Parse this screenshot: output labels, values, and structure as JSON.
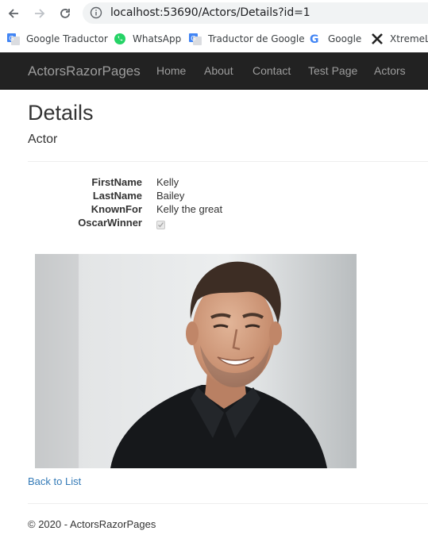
{
  "browser": {
    "url": "localhost:53690/Actors/Details?id=1",
    "bookmarks": [
      {
        "label": "Google Traductor",
        "icon": "google-translate-icon"
      },
      {
        "label": "WhatsApp",
        "icon": "whatsapp-icon"
      },
      {
        "label": "Traductor de Google",
        "icon": "google-translate-icon"
      },
      {
        "label": "Google",
        "icon": "google-g-icon"
      },
      {
        "label": "XtremeLa",
        "icon": "xtreme-icon"
      }
    ]
  },
  "navbar": {
    "brand": "ActorsRazorPages",
    "links": [
      "Home",
      "About",
      "Contact",
      "Test Page",
      "Actors"
    ]
  },
  "page": {
    "title": "Details",
    "subtitle": "Actor"
  },
  "details": [
    {
      "label": "FirstName",
      "value": "Kelly"
    },
    {
      "label": "LastName",
      "value": "Bailey"
    },
    {
      "label": "KnownFor",
      "value": "Kelly the great"
    },
    {
      "label": "OscarWinner",
      "checked": true
    }
  ],
  "back_link": "Back to List",
  "footer": "© 2020 - ActorsRazorPages",
  "colors": {
    "navbar_bg": "#222222",
    "nav_text": "#9d9d9d",
    "link": "#337ab7"
  }
}
